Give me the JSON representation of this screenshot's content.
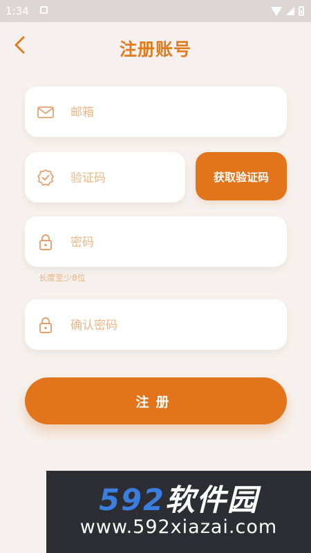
{
  "status_bar": {
    "time": "1:34"
  },
  "header": {
    "title": "注册账号"
  },
  "form": {
    "email": {
      "placeholder": "邮箱",
      "value": ""
    },
    "code": {
      "placeholder": "验证码",
      "value": ""
    },
    "get_code_label": "获取验证码",
    "password": {
      "placeholder": "密码",
      "value": "",
      "hint": "长度至少8位"
    },
    "confirm_password": {
      "placeholder": "确认密码",
      "value": ""
    },
    "submit_label": "注册"
  },
  "watermark": {
    "brand_num": "592",
    "brand_cn": "软件园",
    "url": "www.592xiazai.com"
  },
  "colors": {
    "accent": "#e2741b",
    "background": "#f6f1ee",
    "placeholder": "#efb585"
  }
}
